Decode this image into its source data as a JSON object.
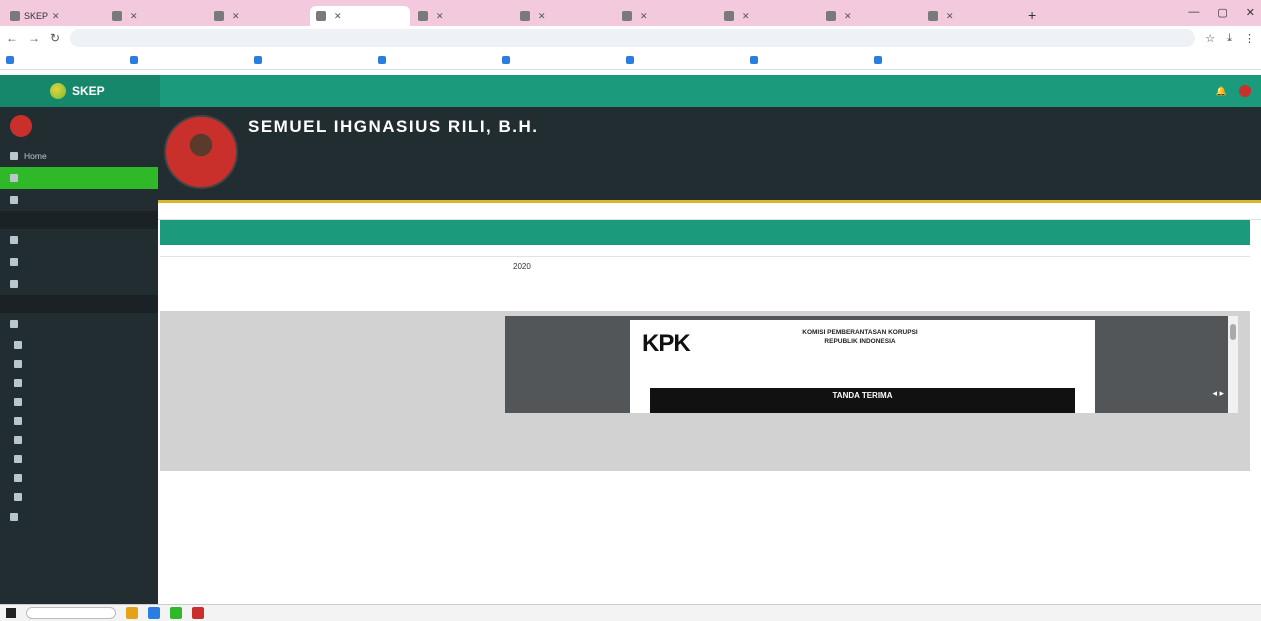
{
  "browser": {
    "tabs": [
      {
        "label": "SKEP",
        "active": false
      },
      {
        "label": "",
        "active": false
      },
      {
        "label": "",
        "active": false
      },
      {
        "label": "",
        "active": true
      },
      {
        "label": "",
        "active": false
      },
      {
        "label": "",
        "active": false
      },
      {
        "label": "",
        "active": false
      },
      {
        "label": "",
        "active": false
      },
      {
        "label": "",
        "active": false
      },
      {
        "label": "",
        "active": false
      }
    ],
    "new_tab": "+",
    "window_controls": {
      "minimize": "—",
      "maximize": "▢",
      "close": "✕"
    },
    "back": "←",
    "forward": "→",
    "reload": "↻",
    "url": "",
    "bookmarks": [
      "",
      "",
      "",
      "",
      "",
      "",
      "",
      ""
    ]
  },
  "app": {
    "brand": "SKEP",
    "colors": {
      "primary": "#1b9b7c",
      "sidebar": "#222d32",
      "active": "#2fb928",
      "accent": "#d8b829"
    }
  },
  "sidebar": {
    "user_name": "",
    "user_status": "",
    "items": [
      {
        "label": "Home",
        "active": false,
        "kind": "item"
      },
      {
        "label": "",
        "active": true,
        "kind": "item"
      },
      {
        "label": "",
        "active": false,
        "kind": "item"
      },
      {
        "label": "",
        "active": false,
        "kind": "header"
      },
      {
        "label": "",
        "active": false,
        "kind": "item"
      },
      {
        "label": "",
        "active": false,
        "kind": "item"
      },
      {
        "label": "",
        "active": false,
        "kind": "item"
      },
      {
        "label": "",
        "active": false,
        "kind": "header"
      },
      {
        "label": "",
        "active": false,
        "kind": "item"
      },
      {
        "label": "",
        "active": false,
        "kind": "sub"
      },
      {
        "label": "",
        "active": false,
        "kind": "sub"
      },
      {
        "label": "",
        "active": false,
        "kind": "sub"
      },
      {
        "label": "",
        "active": false,
        "kind": "sub"
      },
      {
        "label": "",
        "active": false,
        "kind": "sub"
      },
      {
        "label": "",
        "active": false,
        "kind": "sub"
      },
      {
        "label": "",
        "active": false,
        "kind": "sub"
      },
      {
        "label": "",
        "active": false,
        "kind": "sub"
      },
      {
        "label": "",
        "active": false,
        "kind": "sub"
      },
      {
        "label": "",
        "active": false,
        "kind": "item"
      }
    ]
  },
  "profile": {
    "name": "SEMUEL IHGNASIUS RILI, B.H.",
    "lines": [
      "",
      "",
      "",
      ""
    ],
    "meta": ""
  },
  "breadcrumb": {
    "path": "",
    "back": ""
  },
  "panel": {
    "title": "",
    "fields": [
      {
        "label": "",
        "value": "2020"
      },
      {
        "label": "",
        "value": ""
      },
      {
        "label": "",
        "value": ""
      }
    ],
    "document_label": ""
  },
  "pdf": {
    "logo": "KPK",
    "logo_tagline": "",
    "org_lines": [
      "KOMISI PEMBERANTASAN KORUPSI",
      "REPUBLIK INDONESIA",
      "",
      ""
    ],
    "banner_lines": [
      "TANDA TERIMA",
      ""
    ],
    "page_control": "◂ ▸"
  },
  "footer": "",
  "taskbar": {
    "search_placeholder": "",
    "clock": "",
    "date": ""
  }
}
